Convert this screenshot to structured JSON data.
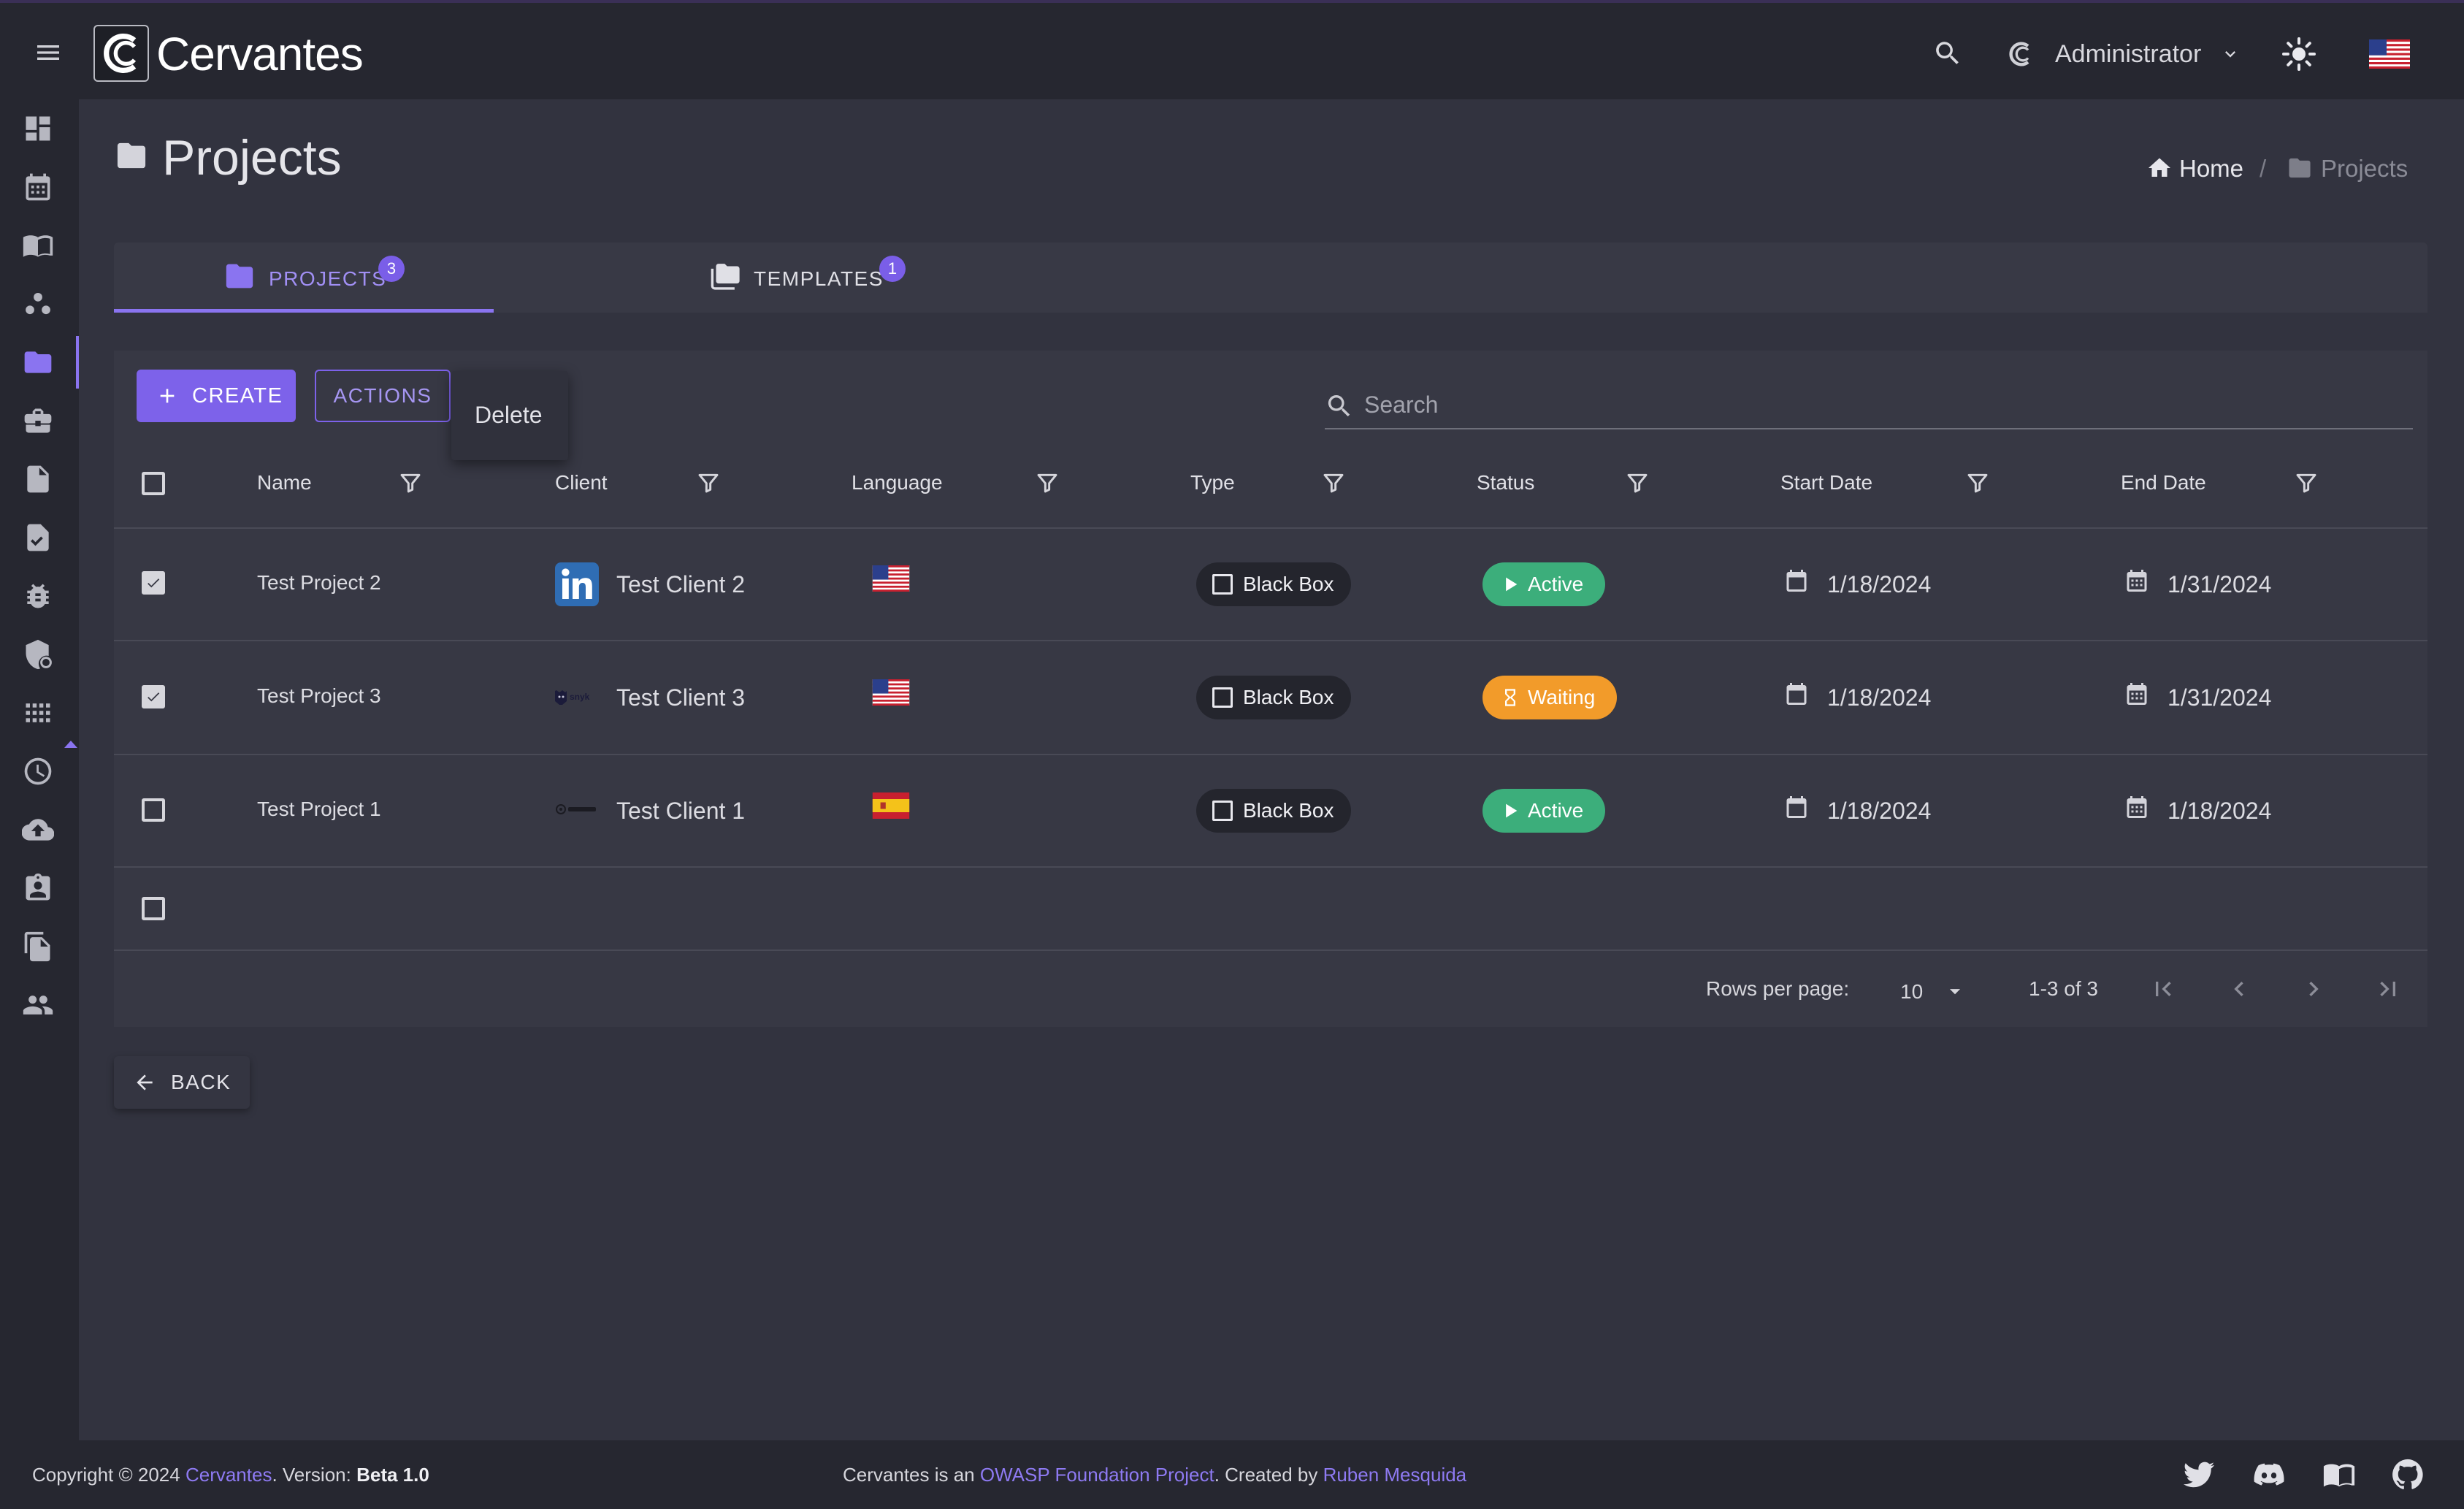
{
  "app": {
    "name": "Cervantes",
    "user": "Administrator"
  },
  "page": {
    "title": "Projects",
    "breadcrumb": {
      "home": "Home",
      "separator": "/",
      "current": "Projects"
    }
  },
  "tabs": [
    {
      "label": "PROJECTS",
      "badge": "3",
      "active": true
    },
    {
      "label": "TEMPLATES",
      "badge": "1",
      "active": false
    }
  ],
  "toolbar": {
    "create_label": "CREATE",
    "actions_label": "ACTIONS",
    "menu_items": [
      "Delete"
    ],
    "search_placeholder": "Search"
  },
  "table": {
    "headers": [
      "Name",
      "Client",
      "Language",
      "Type",
      "Status",
      "Start Date",
      "End Date"
    ],
    "rows": [
      {
        "checked": true,
        "name": "Test Project 2",
        "client": "Test Client 2",
        "client_logo": "linkedin-logo",
        "language": "us-flag",
        "type": "Black Box",
        "status": "Active",
        "start": "1/18/2024",
        "end": "1/31/2024"
      },
      {
        "checked": true,
        "name": "Test Project 3",
        "client": "Test Client 3",
        "client_logo": "snyk-logo",
        "language": "us-flag",
        "type": "Black Box",
        "status": "Waiting",
        "start": "1/18/2024",
        "end": "1/31/2024"
      },
      {
        "checked": false,
        "name": "Test Project 1",
        "client": "Test Client 1",
        "client_logo": "generic-logo",
        "language": "es-flag",
        "type": "Black Box",
        "status": "Active",
        "start": "1/18/2024",
        "end": "1/18/2024"
      }
    ],
    "pagination": {
      "rows_per_page_label": "Rows per page:",
      "rows_per_page": "10",
      "range": "1-3 of 3"
    }
  },
  "back_label": "BACK",
  "footer": {
    "copyright_prefix": "Copyright © 2024 ",
    "brand": "Cervantes",
    "version_prefix": ". Version: ",
    "version": "Beta 1.0",
    "project_prefix": "Cervantes is an ",
    "owasp": "OWASP Foundation Project",
    "created_by": ". Created by ",
    "author": "Ruben Mesquida"
  },
  "colors": {
    "accent": "#7d62ea",
    "active": "#3cae7b",
    "waiting": "#f29b2a",
    "bg": "#32333f",
    "panel": "#262730"
  },
  "icons": {
    "sidebar": [
      "dashboard-icon",
      "calendar-icon",
      "book-icon",
      "clients-icon",
      "folder-icon",
      "briefcase-icon",
      "document-icon",
      "checklist-icon",
      "bug-icon",
      "shield-icon",
      "grid-icon",
      "clock-icon",
      "cloud-upload-icon",
      "contact-icon",
      "files-icon",
      "users-icon"
    ],
    "footer": [
      "twitter-icon",
      "discord-icon",
      "docs-icon",
      "github-icon"
    ]
  }
}
